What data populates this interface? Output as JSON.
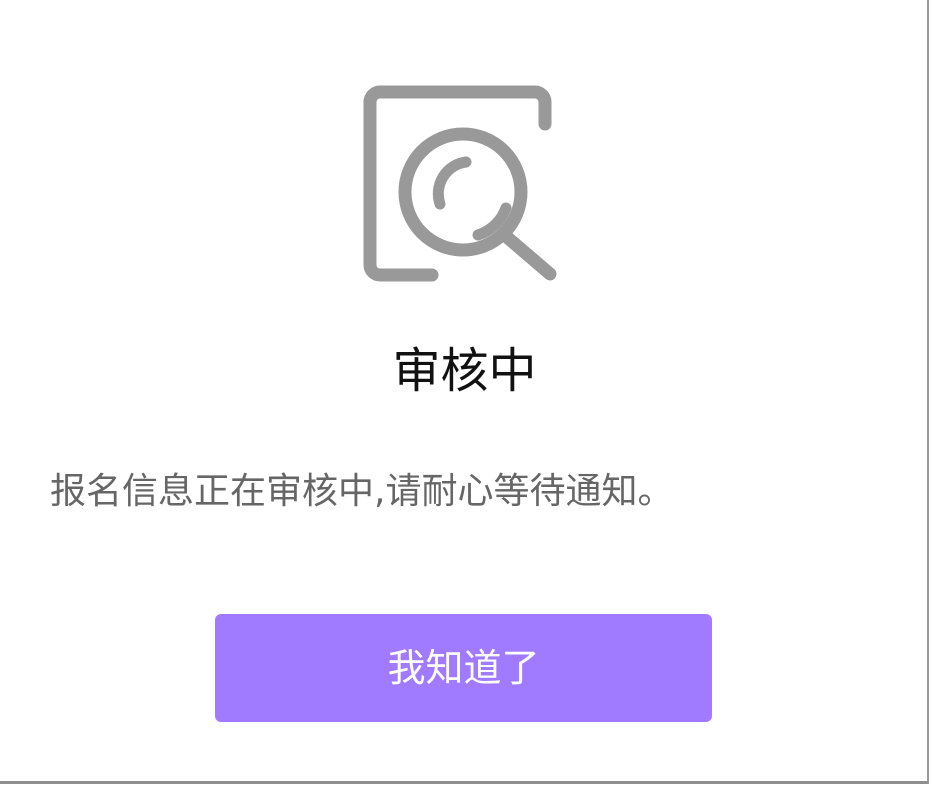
{
  "dialog": {
    "icon": "document-search-icon",
    "title": "审核中",
    "message": "报名信息正在审核中,请耐心等待通知。",
    "confirm_label": "我知道了"
  },
  "colors": {
    "button_bg": "#a17bff",
    "button_text": "#ffffff",
    "icon": "#999999",
    "title": "#111111",
    "message": "#666666"
  }
}
